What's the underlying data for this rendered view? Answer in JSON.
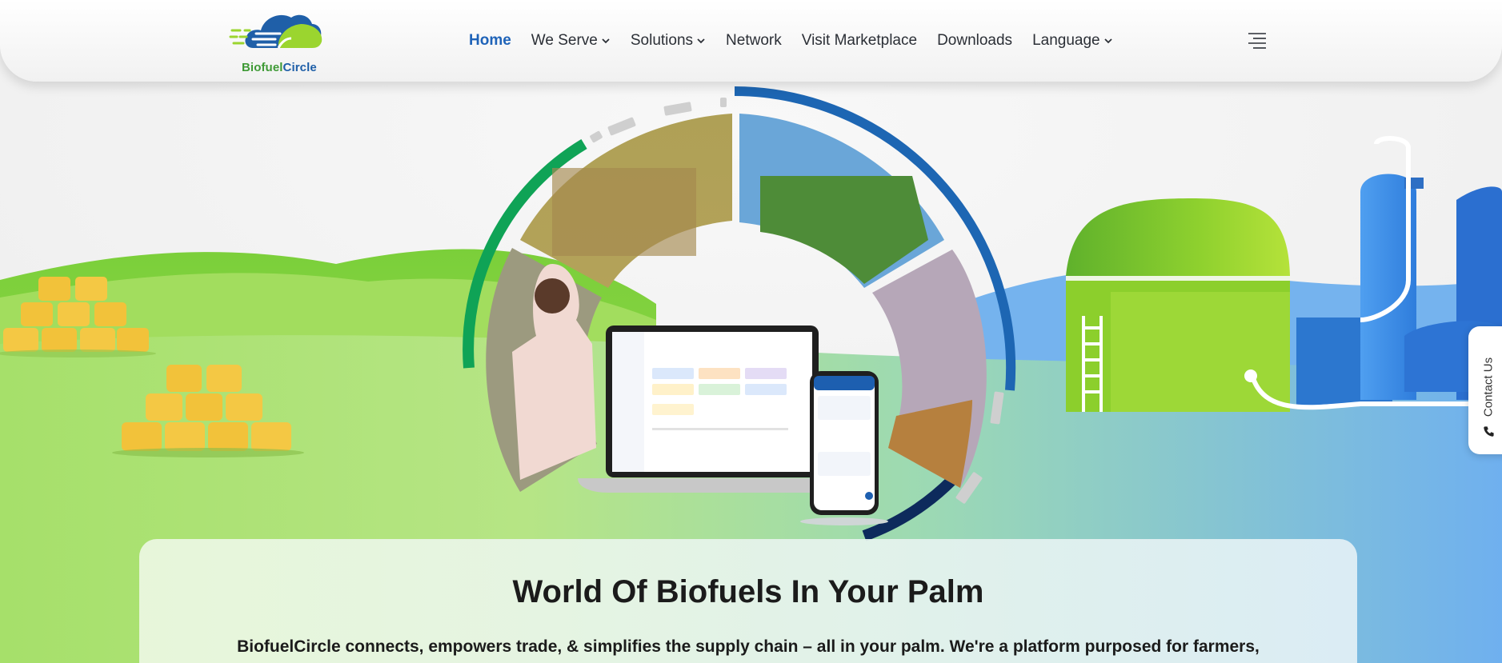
{
  "brand": {
    "name_part1": "Biofuel",
    "name_part2": "Circle",
    "logo_icon": "biofuelcircle-cloud-logo",
    "colors": {
      "green": "#3f9a36",
      "blue": "#1f5fa8",
      "lime": "#9bd52f"
    }
  },
  "nav": {
    "items": [
      {
        "label": "Home",
        "active": true,
        "dropdown": false
      },
      {
        "label": "We Serve",
        "active": false,
        "dropdown": true
      },
      {
        "label": "Solutions",
        "active": false,
        "dropdown": true
      },
      {
        "label": "Network",
        "active": false,
        "dropdown": false
      },
      {
        "label": "Visit Marketplace",
        "active": false,
        "dropdown": false
      },
      {
        "label": "Downloads",
        "active": false,
        "dropdown": false
      },
      {
        "label": "Language",
        "active": false,
        "dropdown": true
      }
    ],
    "menu_icon": "hamburger-menu-icon",
    "active_color": "#1f63b8"
  },
  "contact_tab": {
    "label": "Contact Us",
    "icon": "phone-icon"
  },
  "hero": {
    "title": "World Of Biofuels In Your Palm",
    "description": "BiofuelCircle connects, empowers trade, & simplifies the supply chain – all in your palm. We're a platform purposed for farmers, biofuel producers, industrial buyers & logistics players for everything biofuels."
  }
}
